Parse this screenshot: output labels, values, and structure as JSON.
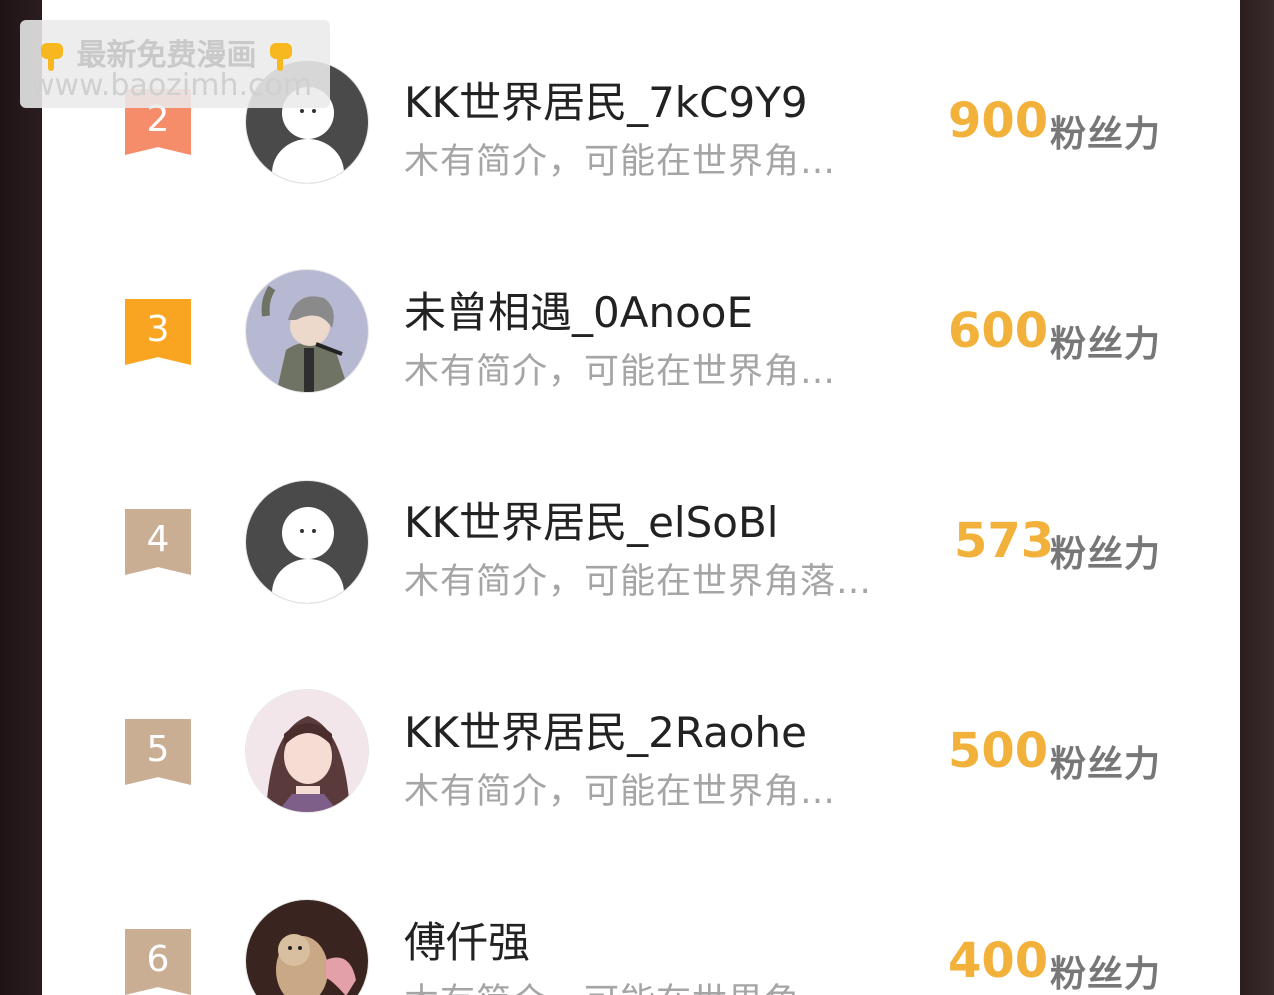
{
  "watermark": {
    "line1": "最新免费漫画",
    "line2": "www.baozimh.com",
    "icon": "pointing-down-hand-icon"
  },
  "unit_label": "粉丝力",
  "colors": {
    "score": "#f2b13b",
    "rank2": "#f58d6a",
    "rank3": "#f9a522",
    "rank_other": "#c9ae93"
  },
  "rows": [
    {
      "rank": "2",
      "name": "KK世界居民_7kC9Y9",
      "bio": "木有简介，可能在世界角…",
      "score": "900",
      "avatar": "default-avatar"
    },
    {
      "rank": "3",
      "name": "未曾相遇_0AnooE",
      "bio": "木有简介，可能在世界角…",
      "score": "600",
      "avatar": "singer-avatar"
    },
    {
      "rank": "4",
      "name": "KK世界居民_elSoBl",
      "bio": "木有简介，可能在世界角落…",
      "score": "573",
      "avatar": "default-avatar"
    },
    {
      "rank": "5",
      "name": "KK世界居民_2Raohe",
      "bio": "木有简介，可能在世界角…",
      "score": "500",
      "avatar": "anime-character-avatar"
    },
    {
      "rank": "6",
      "name": "傅仟强",
      "bio": "木有简介，可能在世界角…",
      "score": "400",
      "avatar": "cat-avatar"
    }
  ]
}
